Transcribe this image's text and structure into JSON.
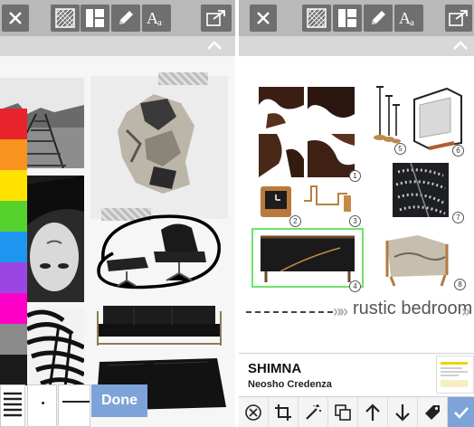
{
  "left_screen": {
    "toolbar": {
      "icons": [
        "close-icon",
        "texture-icon",
        "layout-icon",
        "pencil-icon",
        "text-icon",
        "share-icon"
      ]
    },
    "subbar": {
      "icon": "chevron-up-icon"
    },
    "swatches": [
      "#e8232b",
      "#f7931e",
      "#ffe200",
      "#55d22b",
      "#1e96f0",
      "#9b46e3",
      "#ff00c8",
      "#8a8a8a",
      "#1a1a1a"
    ],
    "bottom_bar": {
      "done_label": "Done"
    }
  },
  "right_screen": {
    "toolbar": {
      "icons": [
        "close-icon",
        "texture-icon",
        "layout-icon",
        "pencil-icon",
        "text-icon",
        "share-icon"
      ]
    },
    "board": {
      "badges": [
        "1",
        "2",
        "3",
        "4",
        "5",
        "6",
        "7",
        "8"
      ],
      "title": "rustic bedroom"
    },
    "selected_item": {
      "brand": "SHIMNA",
      "name": "Neosho Credenza"
    },
    "actions": [
      "close-circle-icon",
      "crop-icon",
      "magic-wand-icon",
      "duplicate-icon",
      "arrow-up-icon",
      "arrow-down-icon",
      "tag-icon",
      "check-icon"
    ],
    "colors": {
      "accent": "#7ea3d9",
      "selection": "#6fe26a"
    }
  }
}
